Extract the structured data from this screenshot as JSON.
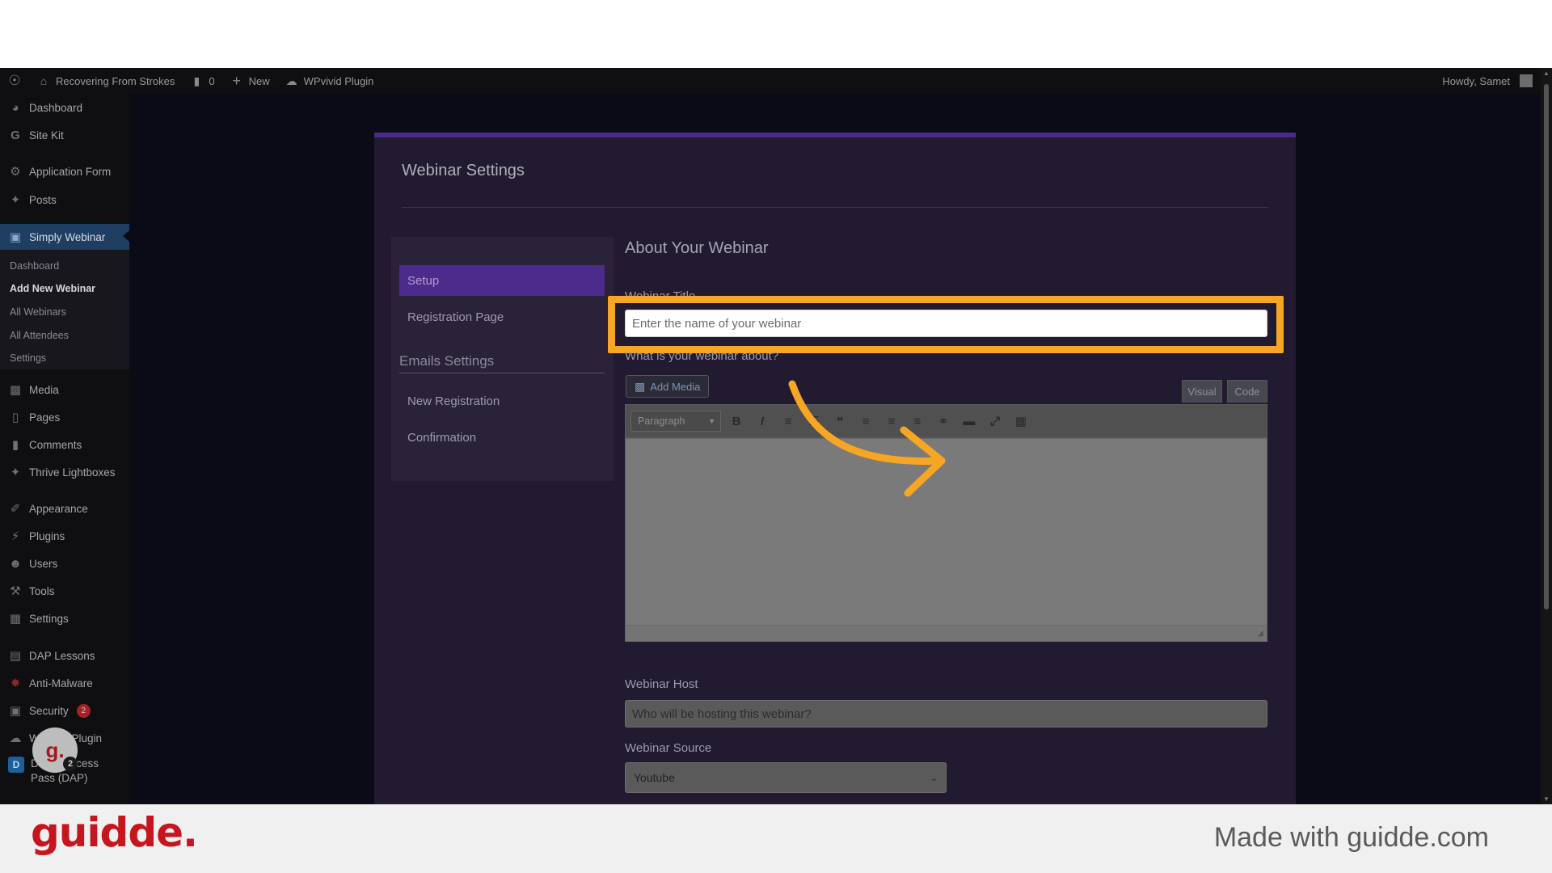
{
  "adminbar": {
    "site_name": "Recovering From Strokes",
    "comments_count": "0",
    "new_label": "New",
    "plugin_label": "WPvivid Plugin",
    "greeting": "Howdy, Samet"
  },
  "sidebar": {
    "items": [
      {
        "label": "Dashboard",
        "icon": "dashboard-icon"
      },
      {
        "label": "Site Kit",
        "icon": "google-icon"
      },
      {
        "label": "Application Form",
        "icon": "gear-icon"
      },
      {
        "label": "Posts",
        "icon": "pin-icon"
      },
      {
        "label": "Simply Webinar",
        "icon": "webinar-icon"
      },
      {
        "label": "Media",
        "icon": "media-icon"
      },
      {
        "label": "Pages",
        "icon": "pages-icon"
      },
      {
        "label": "Comments",
        "icon": "comment-icon"
      },
      {
        "label": "Thrive Lightboxes",
        "icon": "pin-icon"
      },
      {
        "label": "Appearance",
        "icon": "brush-icon"
      },
      {
        "label": "Plugins",
        "icon": "plug-icon"
      },
      {
        "label": "Users",
        "icon": "user-icon"
      },
      {
        "label": "Tools",
        "icon": "wrench-icon"
      },
      {
        "label": "Settings",
        "icon": "settings-icon"
      },
      {
        "label": "DAP Lessons",
        "icon": "book-icon"
      },
      {
        "label": "Anti-Malware",
        "icon": "shield-icon"
      },
      {
        "label": "Security",
        "icon": "lock-icon",
        "badge": "2"
      },
      {
        "label": "WPvivid Plugin",
        "icon": "cloud-icon"
      },
      {
        "label": "Digital Access Pass (DAP)",
        "icon": "dap-icon"
      }
    ],
    "submenu": [
      "Dashboard",
      "Add New Webinar",
      "All Webinars",
      "All Attendees",
      "Settings"
    ]
  },
  "panel": {
    "title": "Webinar Settings",
    "subnav": {
      "setup": "Setup",
      "registration": "Registration Page",
      "emails_heading": "Emails Settings",
      "new_registration": "New Registration",
      "confirmation": "Confirmation"
    },
    "about_title": "About Your Webinar",
    "webinar_title_label": "Webinar Title",
    "webinar_title_placeholder": "Enter the name of your webinar",
    "about_label": "What is your webinar about?",
    "add_media": "Add Media",
    "tab_visual": "Visual",
    "tab_code": "Code",
    "format_value": "Paragraph",
    "host_label": "Webinar Host",
    "host_placeholder": "Who will be hosting this webinar?",
    "source_label": "Webinar Source",
    "source_value": "Youtube"
  },
  "overlay": {
    "avatar_letter": "g.",
    "avatar_count": "2",
    "highlight_color": "#f6a623"
  },
  "footer": {
    "logo": "guidde.",
    "text": "Made with guidde.com"
  }
}
